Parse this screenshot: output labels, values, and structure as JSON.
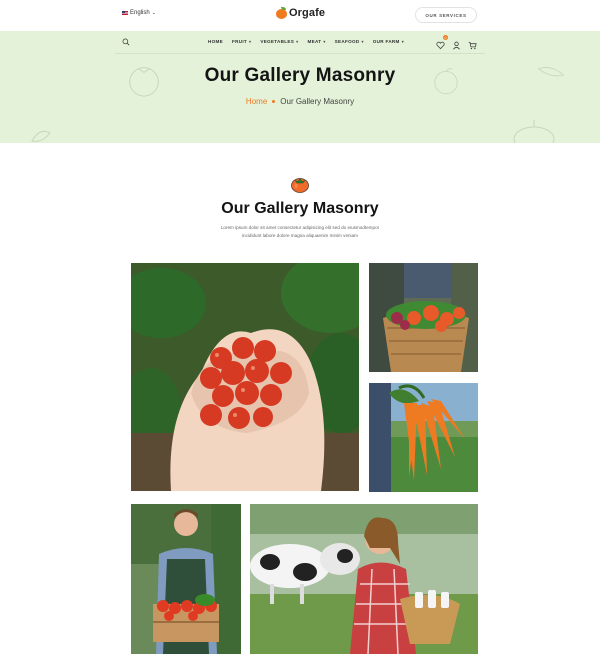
{
  "topbar": {
    "language": "English",
    "brand": "Orgafe",
    "services_label": "OUR SERVICES"
  },
  "nav": {
    "items": [
      {
        "label": "HOME",
        "has_dropdown": false
      },
      {
        "label": "FRUIT",
        "has_dropdown": true
      },
      {
        "label": "VEGETABLES",
        "has_dropdown": true
      },
      {
        "label": "MEAT",
        "has_dropdown": true
      },
      {
        "label": "SEAFOOD",
        "has_dropdown": true
      },
      {
        "label": "OUR FARM",
        "has_dropdown": true
      }
    ],
    "wishlist_count": "0"
  },
  "hero": {
    "title": "Our Gallery Masonry",
    "breadcrumb_home": "Home",
    "breadcrumb_current": "Our Gallery Masonry"
  },
  "section": {
    "title": "Our Gallery Masonry",
    "description_line1": "Lorem ipsum dolor sit amet consectetur adipisicing elit sed do eiusmodtempor",
    "description_line2": "incididunt labore dolore magna aliquaenim minim veniam"
  },
  "colors": {
    "accent": "#f07b1e",
    "hero_bg": "#e3f2d9",
    "leaf": "#5da832"
  }
}
